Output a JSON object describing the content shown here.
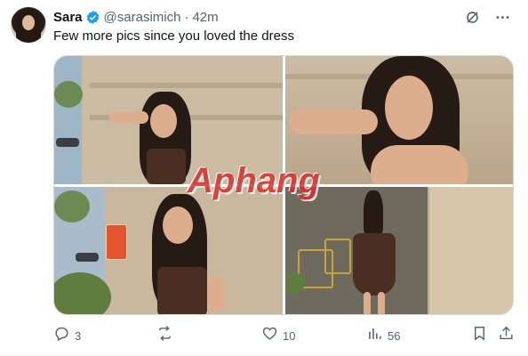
{
  "tweet": {
    "author_name": "Sara",
    "handle": "@sarasimich",
    "separator": "·",
    "time": "42m",
    "text": "Few more pics since you loved the dress",
    "watermark": "Aphang",
    "stats": {
      "replies": "3",
      "reposts": "",
      "likes": "10",
      "views": "56"
    }
  },
  "icons": {
    "verified": "verified-badge-icon",
    "grok": "grok-icon",
    "more": "more-icon",
    "reply": "reply-icon",
    "repost": "repost-icon",
    "like": "heart-icon",
    "views": "views-icon",
    "bookmark": "bookmark-icon",
    "share": "share-icon"
  },
  "colors": {
    "verified": "#1d9bf0",
    "text": "#0f1419",
    "secondary": "#536471",
    "border": "#cfd9de"
  }
}
